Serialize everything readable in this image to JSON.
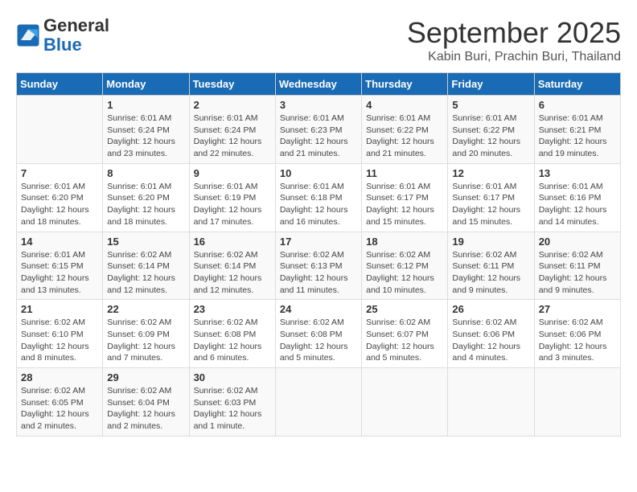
{
  "header": {
    "logo_line1": "General",
    "logo_line2": "Blue",
    "month_title": "September 2025",
    "location": "Kabin Buri, Prachin Buri, Thailand"
  },
  "weekdays": [
    "Sunday",
    "Monday",
    "Tuesday",
    "Wednesday",
    "Thursday",
    "Friday",
    "Saturday"
  ],
  "weeks": [
    [
      {
        "day": "",
        "info": ""
      },
      {
        "day": "1",
        "info": "Sunrise: 6:01 AM\nSunset: 6:24 PM\nDaylight: 12 hours\nand 23 minutes."
      },
      {
        "day": "2",
        "info": "Sunrise: 6:01 AM\nSunset: 6:24 PM\nDaylight: 12 hours\nand 22 minutes."
      },
      {
        "day": "3",
        "info": "Sunrise: 6:01 AM\nSunset: 6:23 PM\nDaylight: 12 hours\nand 21 minutes."
      },
      {
        "day": "4",
        "info": "Sunrise: 6:01 AM\nSunset: 6:22 PM\nDaylight: 12 hours\nand 21 minutes."
      },
      {
        "day": "5",
        "info": "Sunrise: 6:01 AM\nSunset: 6:22 PM\nDaylight: 12 hours\nand 20 minutes."
      },
      {
        "day": "6",
        "info": "Sunrise: 6:01 AM\nSunset: 6:21 PM\nDaylight: 12 hours\nand 19 minutes."
      }
    ],
    [
      {
        "day": "7",
        "info": "Sunrise: 6:01 AM\nSunset: 6:20 PM\nDaylight: 12 hours\nand 18 minutes."
      },
      {
        "day": "8",
        "info": "Sunrise: 6:01 AM\nSunset: 6:20 PM\nDaylight: 12 hours\nand 18 minutes."
      },
      {
        "day": "9",
        "info": "Sunrise: 6:01 AM\nSunset: 6:19 PM\nDaylight: 12 hours\nand 17 minutes."
      },
      {
        "day": "10",
        "info": "Sunrise: 6:01 AM\nSunset: 6:18 PM\nDaylight: 12 hours\nand 16 minutes."
      },
      {
        "day": "11",
        "info": "Sunrise: 6:01 AM\nSunset: 6:17 PM\nDaylight: 12 hours\nand 15 minutes."
      },
      {
        "day": "12",
        "info": "Sunrise: 6:01 AM\nSunset: 6:17 PM\nDaylight: 12 hours\nand 15 minutes."
      },
      {
        "day": "13",
        "info": "Sunrise: 6:01 AM\nSunset: 6:16 PM\nDaylight: 12 hours\nand 14 minutes."
      }
    ],
    [
      {
        "day": "14",
        "info": "Sunrise: 6:01 AM\nSunset: 6:15 PM\nDaylight: 12 hours\nand 13 minutes."
      },
      {
        "day": "15",
        "info": "Sunrise: 6:02 AM\nSunset: 6:14 PM\nDaylight: 12 hours\nand 12 minutes."
      },
      {
        "day": "16",
        "info": "Sunrise: 6:02 AM\nSunset: 6:14 PM\nDaylight: 12 hours\nand 12 minutes."
      },
      {
        "day": "17",
        "info": "Sunrise: 6:02 AM\nSunset: 6:13 PM\nDaylight: 12 hours\nand 11 minutes."
      },
      {
        "day": "18",
        "info": "Sunrise: 6:02 AM\nSunset: 6:12 PM\nDaylight: 12 hours\nand 10 minutes."
      },
      {
        "day": "19",
        "info": "Sunrise: 6:02 AM\nSunset: 6:11 PM\nDaylight: 12 hours\nand 9 minutes."
      },
      {
        "day": "20",
        "info": "Sunrise: 6:02 AM\nSunset: 6:11 PM\nDaylight: 12 hours\nand 9 minutes."
      }
    ],
    [
      {
        "day": "21",
        "info": "Sunrise: 6:02 AM\nSunset: 6:10 PM\nDaylight: 12 hours\nand 8 minutes."
      },
      {
        "day": "22",
        "info": "Sunrise: 6:02 AM\nSunset: 6:09 PM\nDaylight: 12 hours\nand 7 minutes."
      },
      {
        "day": "23",
        "info": "Sunrise: 6:02 AM\nSunset: 6:08 PM\nDaylight: 12 hours\nand 6 minutes."
      },
      {
        "day": "24",
        "info": "Sunrise: 6:02 AM\nSunset: 6:08 PM\nDaylight: 12 hours\nand 5 minutes."
      },
      {
        "day": "25",
        "info": "Sunrise: 6:02 AM\nSunset: 6:07 PM\nDaylight: 12 hours\nand 5 minutes."
      },
      {
        "day": "26",
        "info": "Sunrise: 6:02 AM\nSunset: 6:06 PM\nDaylight: 12 hours\nand 4 minutes."
      },
      {
        "day": "27",
        "info": "Sunrise: 6:02 AM\nSunset: 6:06 PM\nDaylight: 12 hours\nand 3 minutes."
      }
    ],
    [
      {
        "day": "28",
        "info": "Sunrise: 6:02 AM\nSunset: 6:05 PM\nDaylight: 12 hours\nand 2 minutes."
      },
      {
        "day": "29",
        "info": "Sunrise: 6:02 AM\nSunset: 6:04 PM\nDaylight: 12 hours\nand 2 minutes."
      },
      {
        "day": "30",
        "info": "Sunrise: 6:02 AM\nSunset: 6:03 PM\nDaylight: 12 hours\nand 1 minute."
      },
      {
        "day": "",
        "info": ""
      },
      {
        "day": "",
        "info": ""
      },
      {
        "day": "",
        "info": ""
      },
      {
        "day": "",
        "info": ""
      }
    ]
  ]
}
